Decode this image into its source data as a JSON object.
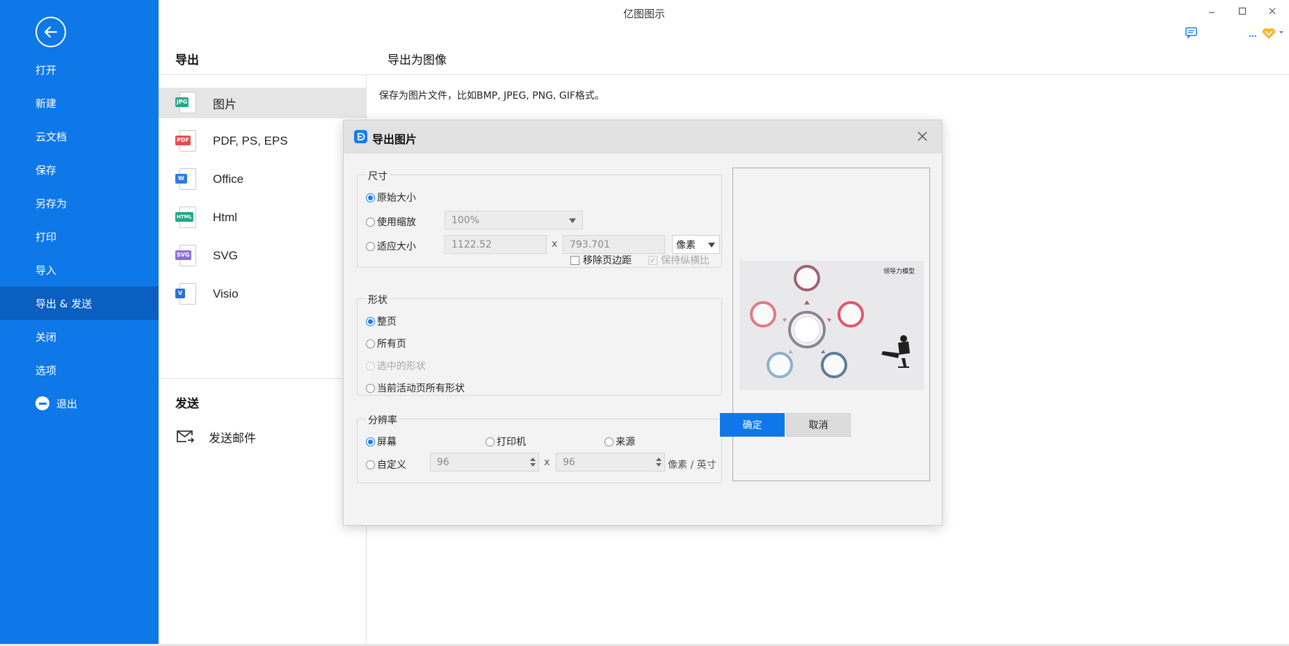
{
  "app": {
    "title": "亿图图示"
  },
  "sidebar": {
    "items": [
      {
        "label": "打开"
      },
      {
        "label": "新建"
      },
      {
        "label": "云文档"
      },
      {
        "label": "保存"
      },
      {
        "label": "另存为"
      },
      {
        "label": "打印"
      },
      {
        "label": "导入"
      },
      {
        "label": "导出 & 发送"
      },
      {
        "label": "关闭"
      },
      {
        "label": "选项"
      },
      {
        "label": "退出"
      }
    ],
    "active": "导出 & 发送",
    "accent": "#0f78e8"
  },
  "toolbar": {
    "more_label": "..."
  },
  "export_panel": {
    "heading": "导出",
    "formats": [
      {
        "label": "图片",
        "icon_text": "JPG",
        "icon_color": "#27a589"
      },
      {
        "label": "PDF, PS, EPS",
        "icon_text": "PDF",
        "icon_color": "#e8494b"
      },
      {
        "label": "Office",
        "icon_text": "W",
        "icon_color": "#2d7be6"
      },
      {
        "label": "Html",
        "icon_text": "HTML",
        "icon_color": "#27a589"
      },
      {
        "label": "SVG",
        "icon_text": "SVG",
        "icon_color": "#8a6fd6"
      },
      {
        "label": "Visio",
        "icon_text": "V",
        "icon_color": "#2d6fd6"
      }
    ],
    "send_heading": "发送",
    "send_items": [
      {
        "label": "发送邮件"
      }
    ]
  },
  "content": {
    "heading": "导出为图像",
    "description": "保存为图片文件，比如BMP, JPEG, PNG, GIF格式。"
  },
  "dialog": {
    "title": "导出图片",
    "size": {
      "group_label": "尺寸",
      "original_label": "原始大小",
      "scale_label": "使用缩放",
      "scale_value": "100%",
      "fit_label": "适应大小",
      "width_value": "1122.52",
      "height_value": "793.701",
      "unit": "像素",
      "remove_margin_label": "移除页边距",
      "keep_ratio_label": "保持纵横比",
      "times": "x"
    },
    "shape": {
      "group_label": "形状",
      "options": [
        "整页",
        "所有页",
        "选中的形状",
        "当前活动页所有形状"
      ]
    },
    "resolution": {
      "group_label": "分辨率",
      "screen_label": "屏幕",
      "printer_label": "打印机",
      "source_label": "来源",
      "custom_label": "自定义",
      "dpi_x": "96",
      "dpi_y": "96",
      "unit_label": "像素 / 英寸",
      "times": "x"
    },
    "preview": {
      "diagram_title": "领导力模型"
    },
    "ok_label": "确定",
    "cancel_label": "取消"
  }
}
